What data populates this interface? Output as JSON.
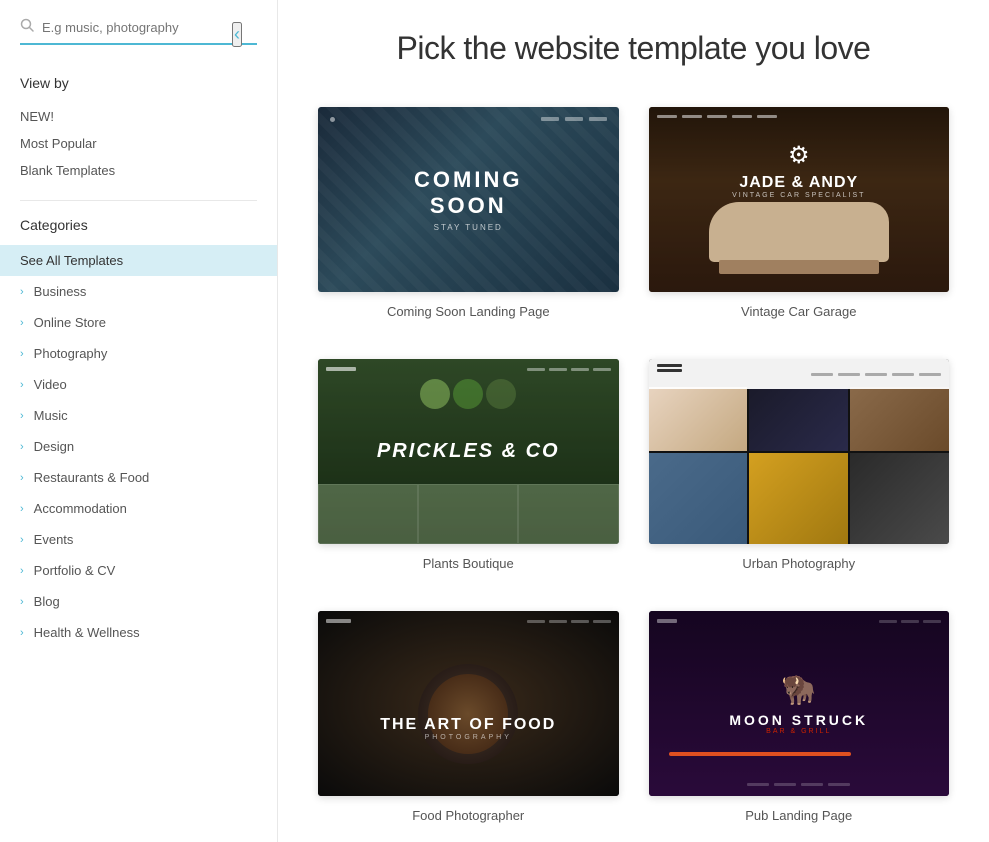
{
  "page": {
    "title": "Pick the website template you love"
  },
  "sidebar": {
    "collapse_icon": "‹",
    "search": {
      "placeholder": "E.g music, photography",
      "value": ""
    },
    "view_by_label": "View by",
    "view_by_items": [
      {
        "id": "new",
        "label": "NEW!"
      },
      {
        "id": "most-popular",
        "label": "Most Popular"
      },
      {
        "id": "blank-templates",
        "label": "Blank Templates"
      }
    ],
    "categories_label": "Categories",
    "categories": [
      {
        "id": "see-all",
        "label": "See All Templates",
        "active": true,
        "has_chevron": false
      },
      {
        "id": "business",
        "label": "Business",
        "has_chevron": true
      },
      {
        "id": "online-store",
        "label": "Online Store",
        "has_chevron": true
      },
      {
        "id": "photography",
        "label": "Photography",
        "has_chevron": true
      },
      {
        "id": "video",
        "label": "Video",
        "has_chevron": true
      },
      {
        "id": "music",
        "label": "Music",
        "has_chevron": true
      },
      {
        "id": "design",
        "label": "Design",
        "has_chevron": true
      },
      {
        "id": "restaurants-food",
        "label": "Restaurants & Food",
        "has_chevron": true
      },
      {
        "id": "accommodation",
        "label": "Accommodation",
        "has_chevron": true
      },
      {
        "id": "events",
        "label": "Events",
        "has_chevron": true
      },
      {
        "id": "portfolio-cv",
        "label": "Portfolio & CV",
        "has_chevron": true
      },
      {
        "id": "blog",
        "label": "Blog",
        "has_chevron": true
      },
      {
        "id": "health-wellness",
        "label": "Health & Wellness",
        "has_chevron": true
      }
    ]
  },
  "templates": [
    {
      "id": "coming-soon",
      "label": "Coming Soon Landing Page",
      "type": "coming-soon"
    },
    {
      "id": "vintage-car",
      "label": "Vintage Car Garage",
      "type": "vintage-car"
    },
    {
      "id": "plants-boutique",
      "label": "Plants Boutique",
      "type": "plants"
    },
    {
      "id": "urban-photography",
      "label": "Urban Photography",
      "type": "urban-photo"
    },
    {
      "id": "food-photographer",
      "label": "Food Photographer",
      "type": "food"
    },
    {
      "id": "pub-landing",
      "label": "Pub Landing Page",
      "type": "pub"
    }
  ]
}
